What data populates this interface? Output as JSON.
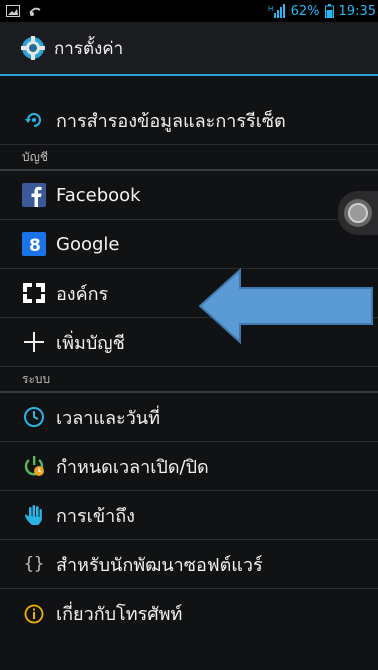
{
  "status_bar": {
    "battery_percent_text": "62%",
    "time": "19:35",
    "accent_color": "#29b6f6"
  },
  "action_bar": {
    "title": "การตั้งค่า",
    "icon": "settings-gear-icon",
    "accent_color": "#23a3d8"
  },
  "list": {
    "backup_item": {
      "label": "การสำรองข้อมูลและการรีเซ็ต",
      "icon": "backup-restore-icon"
    },
    "accounts_section": "บัญชี",
    "accounts": [
      {
        "label": "Facebook",
        "icon": "facebook-icon"
      },
      {
        "label": "Google",
        "icon": "google-icon"
      },
      {
        "label": "องค์กร",
        "icon": "corporate-icon"
      }
    ],
    "add_account": {
      "label": "เพิ่มบัญชี",
      "icon": "plus-icon"
    },
    "system_section": "ระบบ",
    "system": [
      {
        "label": "เวลาและวันที่",
        "icon": "clock-icon"
      },
      {
        "label": "กำหนดเวลาเปิด/ปิด",
        "icon": "power-schedule-icon"
      },
      {
        "label": "การเข้าถึง",
        "icon": "accessibility-hand-icon"
      },
      {
        "label": "สำหรับนักพัฒนาซอฟต์แวร์",
        "icon": "braces-icon"
      },
      {
        "label": "เกี่ยวกับโทรศัพท์",
        "icon": "info-icon"
      }
    ]
  },
  "overlay": {
    "arrow_color": "#5b9bd5",
    "floating_button": "assistive-touch-icon"
  }
}
